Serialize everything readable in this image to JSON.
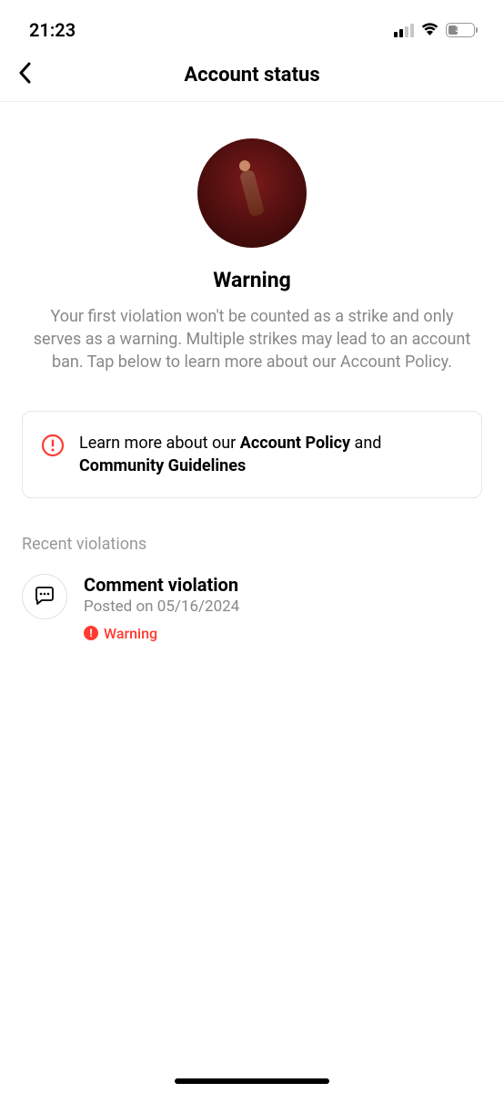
{
  "status_bar": {
    "time": "21:23",
    "battery_percent": "32"
  },
  "nav": {
    "title": "Account status"
  },
  "warning": {
    "heading": "Warning",
    "body": "Your first violation won't be counted as a strike and only serves as a warning. Multiple strikes may lead to an account ban. Tap below to learn more about our Account Policy."
  },
  "policy_card": {
    "prefix": "Learn more about our ",
    "link1": "Account Policy",
    "mid": " and ",
    "link2": "Community Guidelines"
  },
  "section": {
    "recent_violations": "Recent violations"
  },
  "violations": [
    {
      "title": "Comment violation",
      "date": "Posted on 05/16/2024",
      "badge": "Warning"
    }
  ]
}
